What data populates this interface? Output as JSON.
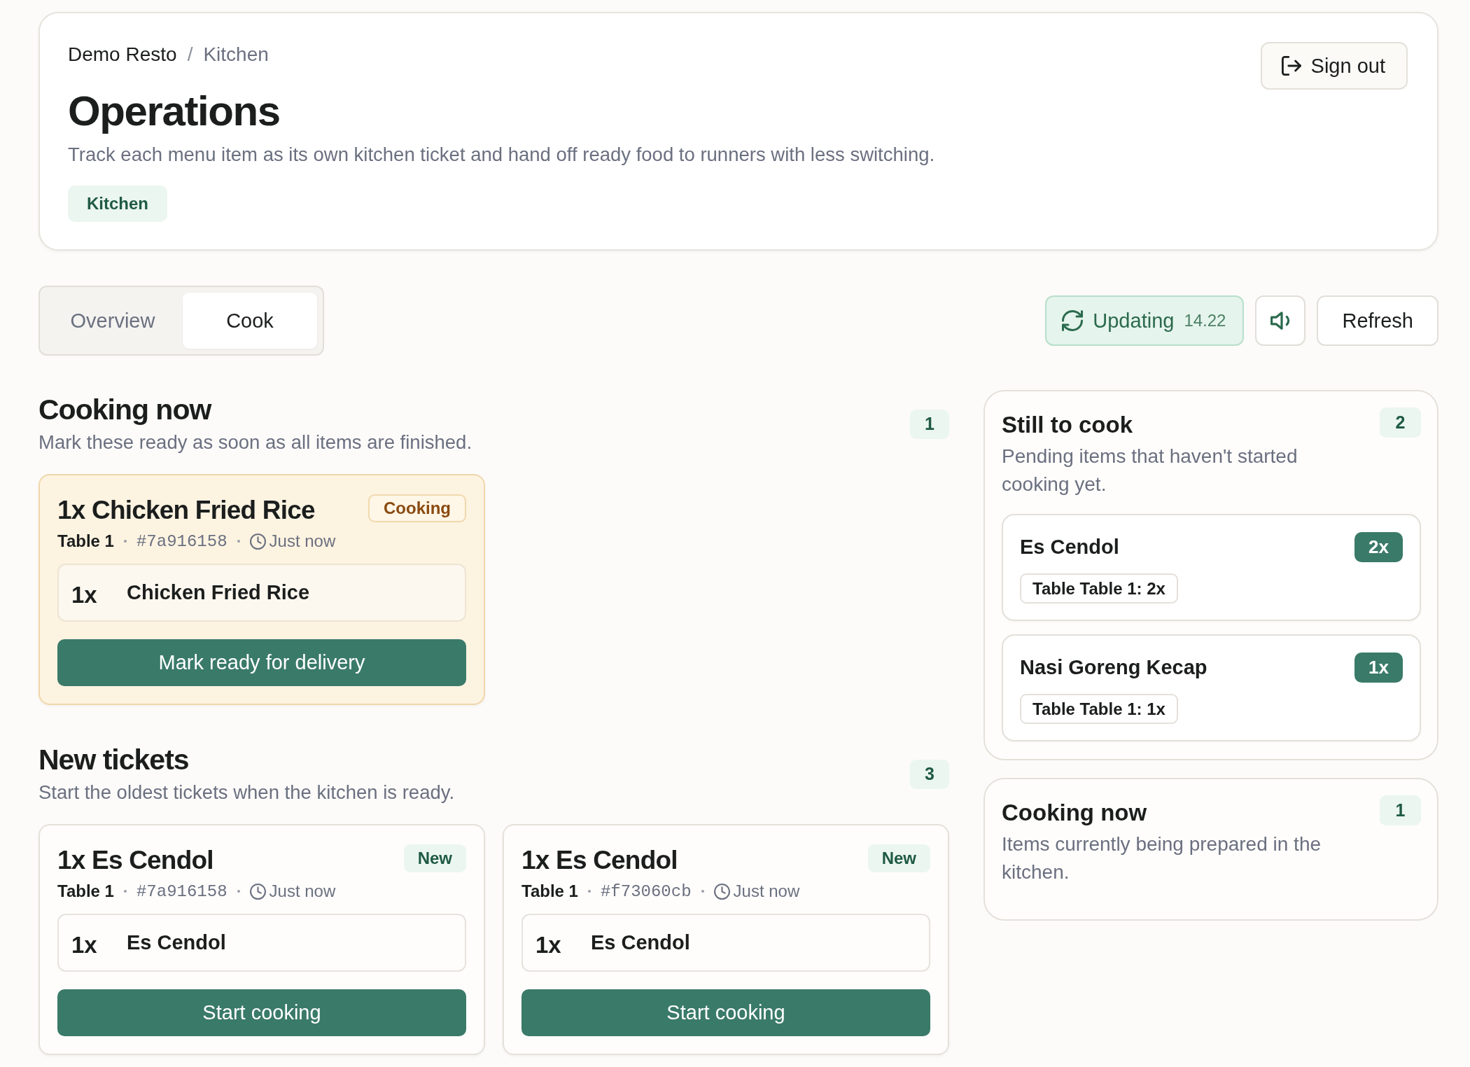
{
  "header": {
    "breadcrumb": [
      {
        "label": "Demo Resto",
        "current": false
      },
      {
        "label": "Kitchen",
        "current": true
      }
    ],
    "breadcrumb_separator": "/",
    "title": "Operations",
    "description": "Track each menu item as its own kitchen ticket and hand off ready food to runners with less switching.",
    "role_badge": "Kitchen",
    "sign_out_button": "Sign out"
  },
  "tabs": [
    {
      "label": "Overview",
      "selected": false
    },
    {
      "label": "Cook",
      "selected": true
    }
  ],
  "toolbar": {
    "live_status": "Updating",
    "last_update": "14.22",
    "refresh_button": "Refresh"
  },
  "sections": [
    {
      "title": "Cooking now",
      "description": "Mark these ready as soon as all items are finished.",
      "count": "1",
      "tickets": [
        {
          "kind": "cooking",
          "title": "1x Chicken Fried Rice",
          "status": "Cooking",
          "table": "Table 1",
          "order_id": "#7a916158",
          "time": "Just now",
          "items": [
            {
              "quantity": "1x",
              "name": "Chicken Fried Rice"
            }
          ],
          "action": "Mark ready for delivery"
        }
      ]
    },
    {
      "title": "New tickets",
      "description": "Start the oldest tickets when the kitchen is ready.",
      "count": "3",
      "tickets": [
        {
          "kind": "new",
          "title": "1x Es Cendol",
          "status": "New",
          "table": "Table 1",
          "order_id": "#7a916158",
          "time": "Just now",
          "items": [
            {
              "quantity": "1x",
              "name": "Es Cendol"
            }
          ],
          "action": "Start cooking"
        },
        {
          "kind": "new",
          "title": "1x Es Cendol",
          "status": "New",
          "table": "Table 1",
          "order_id": "#f73060cb",
          "time": "Just now",
          "items": [
            {
              "quantity": "1x",
              "name": "Es Cendol"
            }
          ],
          "action": "Start cooking"
        }
      ]
    }
  ],
  "summary_panels": [
    {
      "title": "Still to cook",
      "description": "Pending items that haven't started cooking yet.",
      "count": "2",
      "dishes": [
        {
          "name": "Es Cendol",
          "quantity": "2x",
          "tables": [
            "Table Table 1: 2x"
          ]
        },
        {
          "name": "Nasi Goreng Kecap",
          "quantity": "1x",
          "tables": [
            "Table Table 1: 1x"
          ]
        }
      ]
    },
    {
      "title": "Cooking now",
      "description": "Items currently being prepared in the kitchen.",
      "count": "1"
    }
  ]
}
